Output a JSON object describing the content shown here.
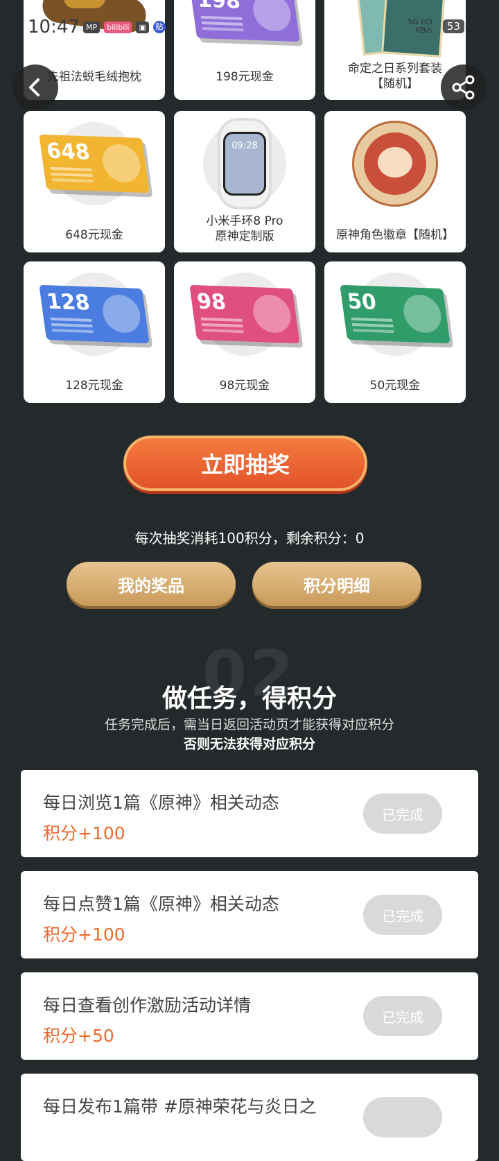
{
  "status_bar": {
    "time": "10:47",
    "badges": [
      "MP",
      "bilibili",
      "▣",
      "贴"
    ],
    "network": [
      "5G HD",
      "KB/s"
    ],
    "battery": "53"
  },
  "prizes": [
    {
      "label": "先祖法蜕毛绒抱枕",
      "type": "plush"
    },
    {
      "label": "198元现金",
      "type": "ticket",
      "amount": "198",
      "color": "#8f6ed9"
    },
    {
      "label": "命定之日系列套装\n【随机】",
      "type": "cards"
    },
    {
      "label": "648元现金",
      "type": "ticket",
      "amount": "648",
      "color": "#f2b531"
    },
    {
      "label": "小米手环8 Pro\n原神定制版",
      "type": "watch"
    },
    {
      "label": "原神角色徽章【随机】",
      "type": "badge"
    },
    {
      "label": "128元现金",
      "type": "ticket",
      "amount": "128",
      "color": "#4b7de0"
    },
    {
      "label": "98元现金",
      "type": "ticket",
      "amount": "98",
      "color": "#e0507e"
    },
    {
      "label": "50元现金",
      "type": "ticket",
      "amount": "50",
      "color": "#2f9c6a"
    }
  ],
  "draw": {
    "button": "立即抽奖",
    "cost_text": "每次抽奖消耗100积分，剩余积分：0",
    "my_prizes": "我的奖品",
    "points_detail": "积分明细"
  },
  "tasks_section": {
    "number": "02",
    "title": "做任务，得积分",
    "note": "任务完成后，需当日返回活动页才能获得对应积分",
    "note_bold": "否则无法获得对应积分"
  },
  "tasks": [
    {
      "name": "每日浏览1篇《原神》相关动态",
      "points": "积分+100",
      "status": "已完成"
    },
    {
      "name": "每日点赞1篇《原神》相关动态",
      "points": "积分+100",
      "status": "已完成"
    },
    {
      "name": "每日查看创作激励活动详情",
      "points": "积分+50",
      "status": "已完成"
    },
    {
      "name": "每日发布1篇带 #原神荣花与炎日之",
      "points": "",
      "status": ""
    }
  ]
}
